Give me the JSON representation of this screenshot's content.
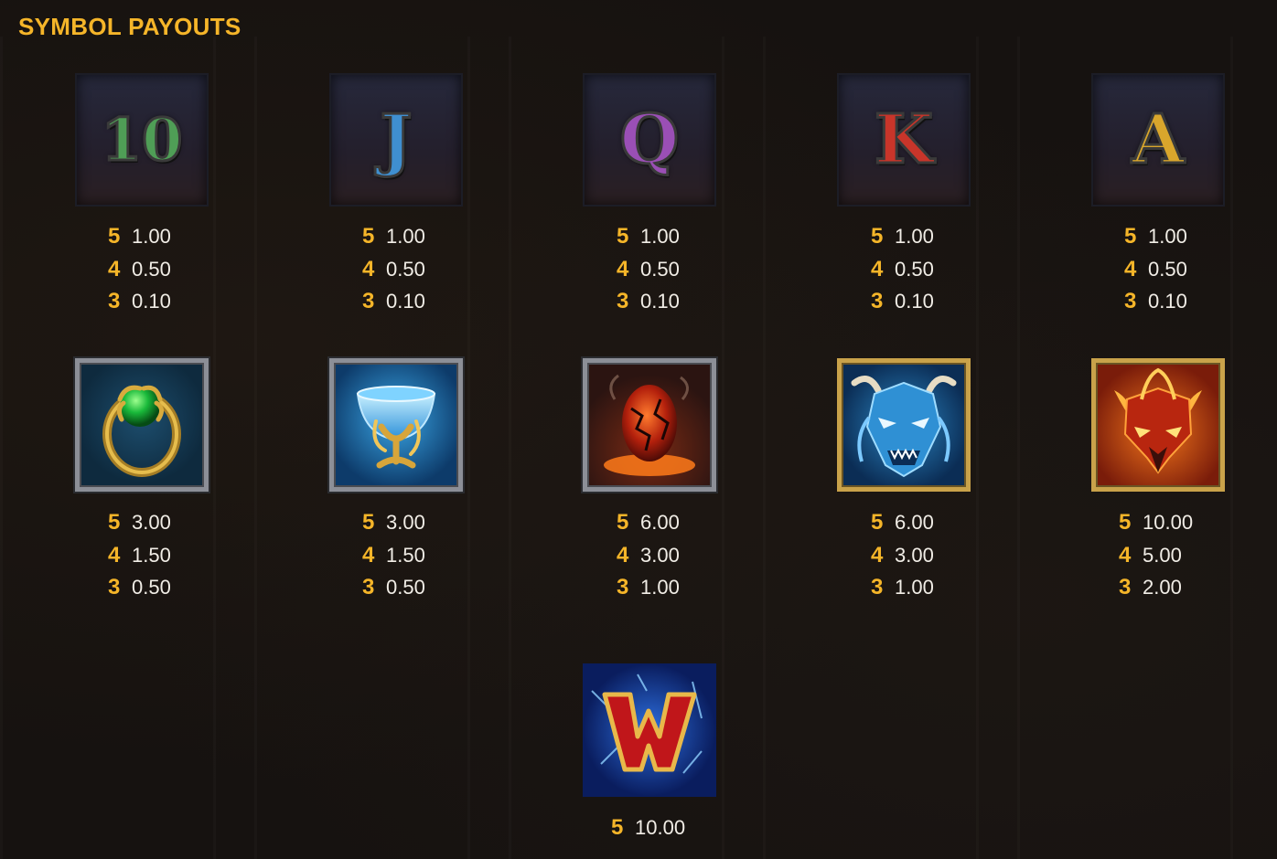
{
  "title": "SYMBOL PAYOUTS",
  "symbols": [
    {
      "id": "ten",
      "glyph": "10",
      "color": "#4f9e56",
      "payouts": [
        {
          "count": "5",
          "value": "1.00"
        },
        {
          "count": "4",
          "value": "0.50"
        },
        {
          "count": "3",
          "value": "0.10"
        }
      ]
    },
    {
      "id": "jack",
      "glyph": "J",
      "color": "#3f8fd0",
      "payouts": [
        {
          "count": "5",
          "value": "1.00"
        },
        {
          "count": "4",
          "value": "0.50"
        },
        {
          "count": "3",
          "value": "0.10"
        }
      ]
    },
    {
      "id": "queen",
      "glyph": "Q",
      "color": "#9a4fb5",
      "payouts": [
        {
          "count": "5",
          "value": "1.00"
        },
        {
          "count": "4",
          "value": "0.50"
        },
        {
          "count": "3",
          "value": "0.10"
        }
      ]
    },
    {
      "id": "king",
      "glyph": "K",
      "color": "#c8352a",
      "payouts": [
        {
          "count": "5",
          "value": "1.00"
        },
        {
          "count": "4",
          "value": "0.50"
        },
        {
          "count": "3",
          "value": "0.10"
        }
      ]
    },
    {
      "id": "ace",
      "glyph": "A",
      "color": "#d9a62c",
      "payouts": [
        {
          "count": "5",
          "value": "1.00"
        },
        {
          "count": "4",
          "value": "0.50"
        },
        {
          "count": "3",
          "value": "0.10"
        }
      ]
    },
    {
      "id": "ring",
      "icon": "green-orb-ring-icon",
      "payouts": [
        {
          "count": "5",
          "value": "3.00"
        },
        {
          "count": "4",
          "value": "1.50"
        },
        {
          "count": "3",
          "value": "0.50"
        }
      ]
    },
    {
      "id": "chalice",
      "icon": "blue-chalice-icon",
      "payouts": [
        {
          "count": "5",
          "value": "3.00"
        },
        {
          "count": "4",
          "value": "1.50"
        },
        {
          "count": "3",
          "value": "0.50"
        }
      ]
    },
    {
      "id": "egg",
      "icon": "lava-dragon-egg-icon",
      "payouts": [
        {
          "count": "5",
          "value": "6.00"
        },
        {
          "count": "4",
          "value": "3.00"
        },
        {
          "count": "3",
          "value": "1.00"
        }
      ]
    },
    {
      "id": "ice-dragon",
      "icon": "ice-dragon-head-icon",
      "payouts": [
        {
          "count": "5",
          "value": "6.00"
        },
        {
          "count": "4",
          "value": "3.00"
        },
        {
          "count": "3",
          "value": "1.00"
        }
      ]
    },
    {
      "id": "fire-dragon",
      "icon": "fire-dragon-head-icon",
      "payouts": [
        {
          "count": "5",
          "value": "10.00"
        },
        {
          "count": "4",
          "value": "5.00"
        },
        {
          "count": "3",
          "value": "2.00"
        }
      ]
    },
    {
      "id": "wild",
      "icon": "wild-w-icon",
      "glyph": "W",
      "payouts": [
        {
          "count": "5",
          "value": "10.00"
        }
      ]
    }
  ]
}
